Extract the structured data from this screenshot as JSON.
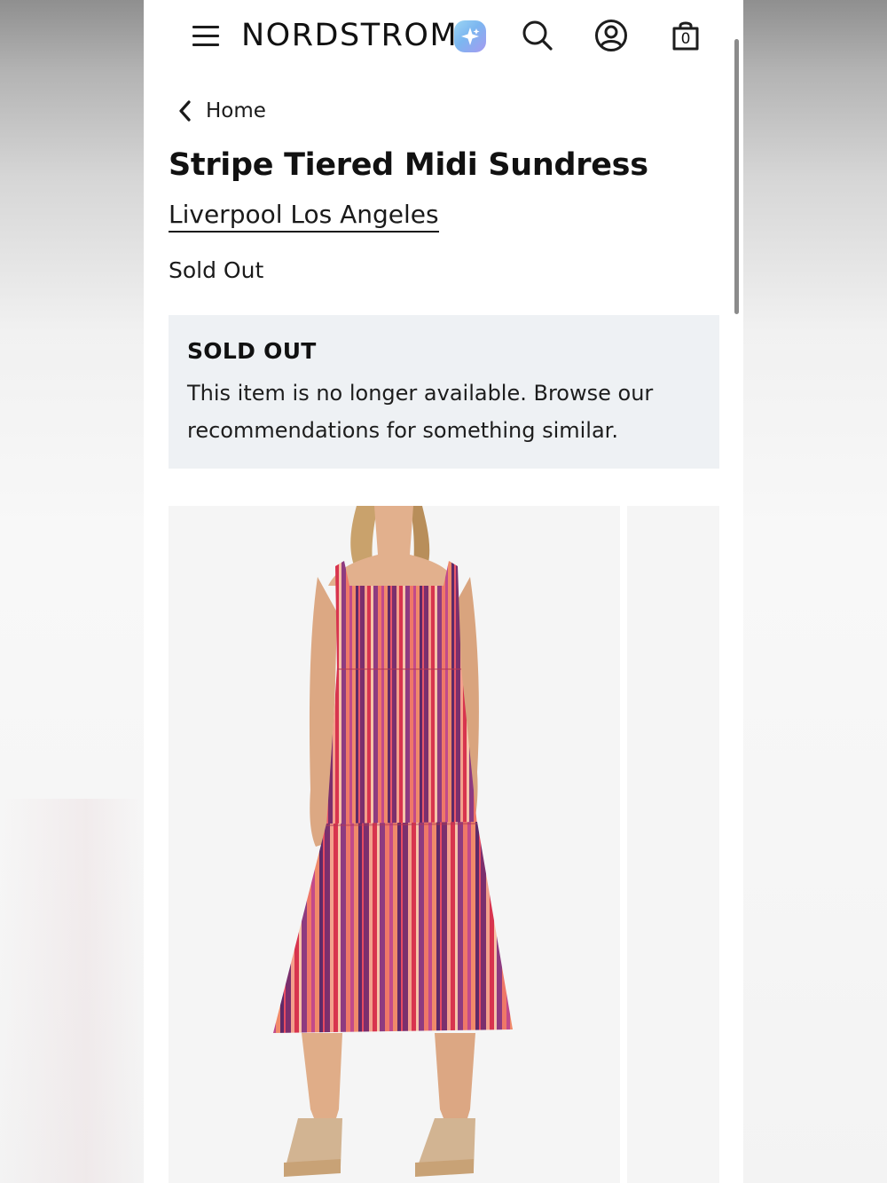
{
  "header": {
    "logo_text": "NORDSTROM",
    "bag_count": "0"
  },
  "breadcrumb": {
    "label": "Home"
  },
  "product": {
    "title": "Stripe Tiered Midi Sundress",
    "brand": "Liverpool Los Angeles",
    "status": "Sold Out"
  },
  "notice": {
    "heading": "SOLD OUT",
    "body": "This item is no longer available. Browse our recommendations for something similar."
  },
  "icons": {
    "menu": "hamburger-menu-icon",
    "ai": "sparkle-ai-icon",
    "search": "search-icon",
    "account": "account-icon",
    "bag": "shopping-bag-icon",
    "back": "chevron-left-icon"
  },
  "colors": {
    "notice_background": "#eef1f4",
    "text": "#111111",
    "photo_background": "#f5f5f5"
  }
}
